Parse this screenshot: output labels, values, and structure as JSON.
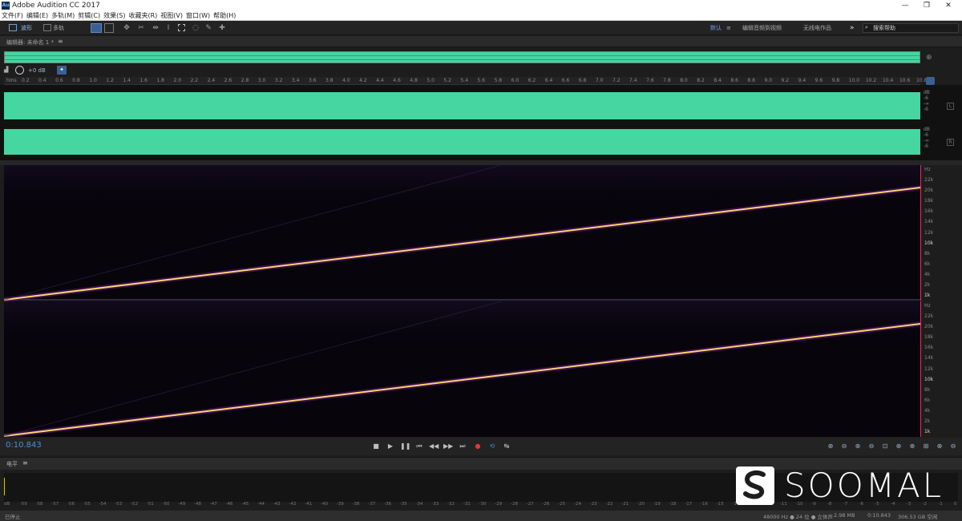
{
  "window": {
    "title": "Adobe Audition CC 2017",
    "app_icon": "Au",
    "controls": [
      "—",
      "❐",
      "✕"
    ]
  },
  "menu": [
    "文件(F)",
    "编辑(E)",
    "多轨(M)",
    "剪辑(C)",
    "效果(S)",
    "收藏夹(R)",
    "视图(V)",
    "窗口(W)",
    "帮助(H)"
  ],
  "toolbar": {
    "waveform_label": "波形",
    "multitrack_label": "多轨",
    "tools": [
      "move-tool-icon",
      "razor-tool-icon",
      "slip-tool-icon",
      "time-selection-tool-icon",
      "marquee-tool-icon",
      "lasso-tool-icon",
      "brush-tool-icon",
      "healing-tool-icon"
    ],
    "workspaces": [
      "默认",
      "编辑音频到视频",
      "无线电作品"
    ],
    "search_placeholder": "搜索帮助"
  },
  "editor": {
    "title": "编辑器: 未命名 1 *"
  },
  "volume": {
    "value": "+0 dB"
  },
  "ruler": {
    "first_label": "hms",
    "labels": [
      "0.2",
      "0.4",
      "0.6",
      "0.8",
      "1.0",
      "1.2",
      "1.4",
      "1.6",
      "1.8",
      "2.0",
      "2.2",
      "2.4",
      "2.6",
      "2.8",
      "3.0",
      "3.2",
      "3.4",
      "3.6",
      "3.8",
      "4.0",
      "4.2",
      "4.4",
      "4.6",
      "4.8",
      "5.0",
      "5.2",
      "5.4",
      "5.6",
      "5.8",
      "6.0",
      "6.2",
      "6.4",
      "6.6",
      "6.8",
      "7.0",
      "7.2",
      "7.4",
      "7.6",
      "7.8",
      "8.0",
      "8.2",
      "8.4",
      "8.6",
      "8.8",
      "9.0",
      "9.2",
      "9.4",
      "9.6",
      "9.8",
      "10.0",
      "10.2",
      "10.4",
      "10.6",
      "10.8"
    ]
  },
  "waveform": {
    "color": "#45d6a2",
    "db_scale_ch1": [
      "dB",
      "-6",
      "-∞",
      "-6"
    ],
    "db_scale_ch2": [
      "dB",
      "-6",
      "-∞",
      "-6"
    ],
    "channel_labels": [
      "L",
      "R"
    ]
  },
  "spectral": {
    "hz_scale": [
      "Hz",
      "22k",
      "20k",
      "18k",
      "16k",
      "14k",
      "12k",
      "10k",
      "8k",
      "6k",
      "4k",
      "2k",
      "1k"
    ]
  },
  "transport": {
    "timecode": "0:10.843",
    "buttons": [
      "stop-icon",
      "play-icon",
      "pause-icon",
      "go-to-start-icon",
      "rewind-icon",
      "fast-forward-icon",
      "go-to-end-icon",
      "record-icon",
      "loop-icon",
      "skip-icon"
    ],
    "zoom_buttons": [
      "zoom-in-amplitude-icon",
      "zoom-out-amplitude-icon",
      "zoom-in-time-icon",
      "zoom-out-time-icon",
      "zoom-out-full-icon",
      "zoom-in-in-point-icon",
      "zoom-in-out-point-icon",
      "zoom-selection-icon",
      "zoom-in-frequency-icon",
      "zoom-out-frequency-icon"
    ]
  },
  "levels": {
    "title": "电平",
    "scale": [
      "dB",
      "-59",
      "-58",
      "-57",
      "-56",
      "-55",
      "-54",
      "-53",
      "-52",
      "-51",
      "-50",
      "-49",
      "-48",
      "-47",
      "-46",
      "-45",
      "-44",
      "-43",
      "-42",
      "-41",
      "-40",
      "-39",
      "-38",
      "-37",
      "-36",
      "-35",
      "-34",
      "-33",
      "-32",
      "-31",
      "-30",
      "-29",
      "-28",
      "-27",
      "-26",
      "-25",
      "-24",
      "-23",
      "-22",
      "-21",
      "-20",
      "-19",
      "-18",
      "-17",
      "-16",
      "-15",
      "-14",
      "-13",
      "-12",
      "-11",
      "-10",
      "-9",
      "-8",
      "-7",
      "-6",
      "-5",
      "-4",
      "-3",
      "-2",
      "-1",
      "0"
    ]
  },
  "status": {
    "left": "已停止",
    "sample_rate": "48000 Hz ● 24 位 ● 立体声",
    "file_size": "2.98 MB",
    "duration": "0:10.843",
    "free_space": "306.53 GB 空闲"
  },
  "watermark": {
    "text": "SOOMAL"
  },
  "colors": {
    "accent": "#4a8fd8",
    "record": "#e0392f",
    "waveform": "#45d6a2",
    "sweep": "#ffd27a"
  }
}
